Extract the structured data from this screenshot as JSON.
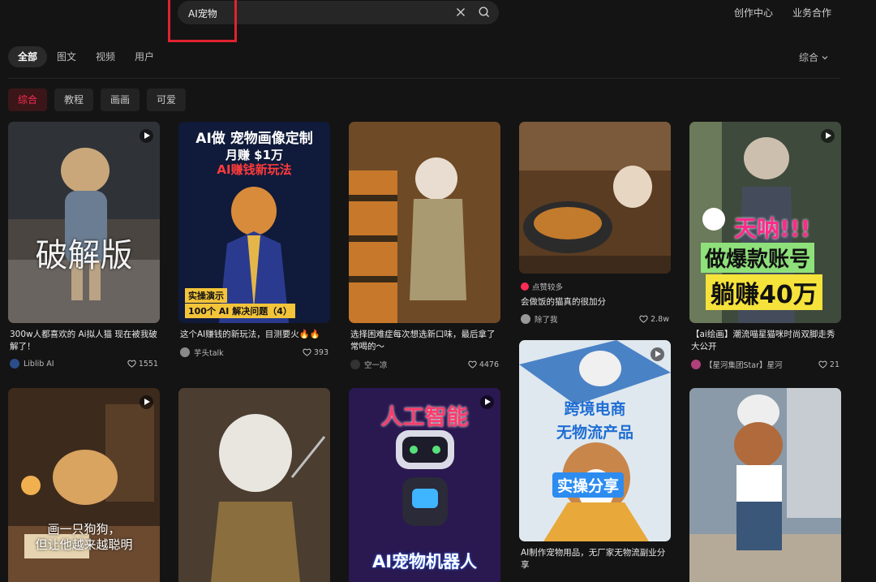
{
  "header": {
    "search_value": "AI宠物",
    "links": [
      "创作中心",
      "业务合作"
    ]
  },
  "tabs": [
    "全部",
    "图文",
    "视频",
    "用户"
  ],
  "sort_label": "综合",
  "chips": [
    "综合",
    "教程",
    "画画",
    "可爱"
  ],
  "accent": "#fe2c55",
  "cards": [
    {
      "overlay": [
        "破解版"
      ],
      "title": "300w人都喜欢的 Ai拟人猫 现在被我破解了！",
      "author": "Liblib AI",
      "likes": "1551"
    },
    {
      "overlay": [
        "AI做 宠物画像定制",
        "月赚 $1万",
        "AI赚钱新玩法",
        "实操演示",
        "100个 AI 解决问题（4）"
      ],
      "title": "这个AI赚钱的新玩法，目测要火🔥🔥",
      "author": "芋头talk",
      "likes": "393"
    },
    {
      "overlay": [],
      "title": "选择困难症每次想选新口味，最后拿了常喝的～",
      "author": "空一凉",
      "likes": "4476"
    },
    {
      "overlay": [],
      "tag": "点赞较多",
      "title": "会做饭的猫真的很加分",
      "author": "除了我",
      "likes": "2.8w"
    },
    {
      "overlay": [
        "天呐!!!",
        "做爆款账号",
        "躺赚40万"
      ],
      "title": "【ai绘画】潮流喵星猫咪时尚双脚走秀大公开",
      "author": "【星河集团Star】星河",
      "likes": "21"
    },
    {
      "overlay": [
        "画一只狗狗，",
        "但让他越来越聪明"
      ],
      "title": "",
      "author": "",
      "likes": ""
    },
    {
      "overlay": [],
      "title": "",
      "author": "",
      "likes": ""
    },
    {
      "overlay": [
        "人工智能",
        "AI宠物机器人"
      ],
      "title": "",
      "author": "",
      "likes": ""
    },
    {
      "overlay": [
        "跨境电商",
        "无物流产品",
        "实操分享"
      ],
      "title": "AI制作宠物用品，无厂家无物流副业分享",
      "author": "",
      "likes": ""
    },
    {
      "overlay": [],
      "title": "",
      "author": "",
      "likes": ""
    }
  ]
}
